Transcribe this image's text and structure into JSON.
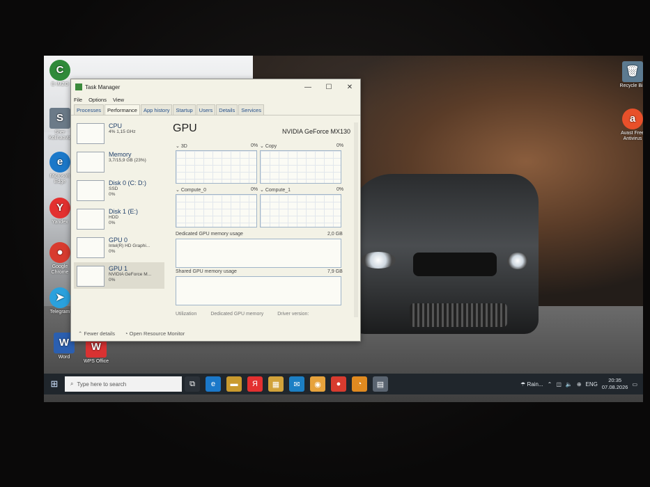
{
  "desktop": {
    "icons": [
      {
        "label": "E-IMZO",
        "glyph": "C",
        "color": "#2f8a3a"
      },
      {
        "label": "Sher Kolinaoviz",
        "glyph": "S",
        "color": "#6b7a88"
      },
      {
        "label": "Microsoft Edge",
        "glyph": "e",
        "color": "#1b78c9"
      },
      {
        "label": "Yandex",
        "glyph": "Y",
        "color": "#e33030"
      },
      {
        "label": "Google Chrome",
        "glyph": "●",
        "color": "#d83b2f"
      },
      {
        "label": "Telegram",
        "glyph": "➤",
        "color": "#2aa1dd"
      },
      {
        "label": "Word",
        "glyph": "W",
        "color": "#2b5fb0"
      },
      {
        "label": "WPS Office",
        "glyph": "W",
        "color": "#d93232"
      },
      {
        "label": "Recycle Bin",
        "glyph": "🗑",
        "color": "#5c7a90"
      },
      {
        "label": "Avast Free Antivirus",
        "glyph": "a",
        "color": "#e8502a"
      }
    ]
  },
  "task_manager": {
    "title": "Task Manager",
    "window_controls": [
      "—",
      "☐",
      "✕"
    ],
    "menu": [
      "File",
      "Options",
      "View"
    ],
    "tabs": [
      "Processes",
      "Performance",
      "App history",
      "Startup",
      "Users",
      "Details",
      "Services"
    ],
    "active_tab": "Performance",
    "sidebar": [
      {
        "name": "CPU",
        "line1": "4% 1,15 GHz",
        "line2": ""
      },
      {
        "name": "Memory",
        "line1": "3,7/15,9 GB (23%)",
        "line2": ""
      },
      {
        "name": "Disk 0 (C: D:)",
        "line1": "SSD",
        "line2": "0%"
      },
      {
        "name": "Disk 1 (E:)",
        "line1": "HDD",
        "line2": "0%"
      },
      {
        "name": "GPU 0",
        "line1": "Intel(R) HD Graphi...",
        "line2": "0%"
      },
      {
        "name": "GPU 1",
        "line1": "NVIDIA GeForce M...",
        "line2": "0%"
      }
    ],
    "selected_index": 5,
    "main": {
      "title": "GPU",
      "model": "NVIDIA GeForce MX130",
      "engines": [
        {
          "label": "3D",
          "pct": "0%"
        },
        {
          "label": "Copy",
          "pct": "0%"
        },
        {
          "label": "Compute_0",
          "pct": "0%"
        },
        {
          "label": "Compute_1",
          "pct": "0%"
        }
      ],
      "dedicated_label": "Dedicated GPU memory usage",
      "dedicated_max": "2,0 GB",
      "shared_label": "Shared GPU memory usage",
      "shared_max": "7,9 GB",
      "stats": [
        "Utilization",
        "Dedicated GPU memory",
        "Driver version:"
      ]
    },
    "footer": {
      "fewer": "Fewer details",
      "monitor": "Open Resource Monitor"
    }
  },
  "taskbar": {
    "search_placeholder": "Type here to search",
    "apps": [
      {
        "glyph": "⧉",
        "color": "#2b3138"
      },
      {
        "glyph": "e",
        "color": "#1b78c9"
      },
      {
        "glyph": "▬",
        "color": "#c99a2e"
      },
      {
        "glyph": "Я",
        "color": "#e33030"
      },
      {
        "glyph": "▦",
        "color": "#d1a23a"
      },
      {
        "glyph": "✉",
        "color": "#1c7fc4"
      },
      {
        "glyph": "◉",
        "color": "#e6a23c"
      },
      {
        "glyph": "●",
        "color": "#d83b2f"
      },
      {
        "glyph": "◔",
        "color": "#e08a20"
      },
      {
        "glyph": "▤",
        "color": "#5a6470"
      }
    ],
    "weather": "Rain...",
    "language": "ENG",
    "time": "20:35",
    "date": "07.08.2026"
  }
}
